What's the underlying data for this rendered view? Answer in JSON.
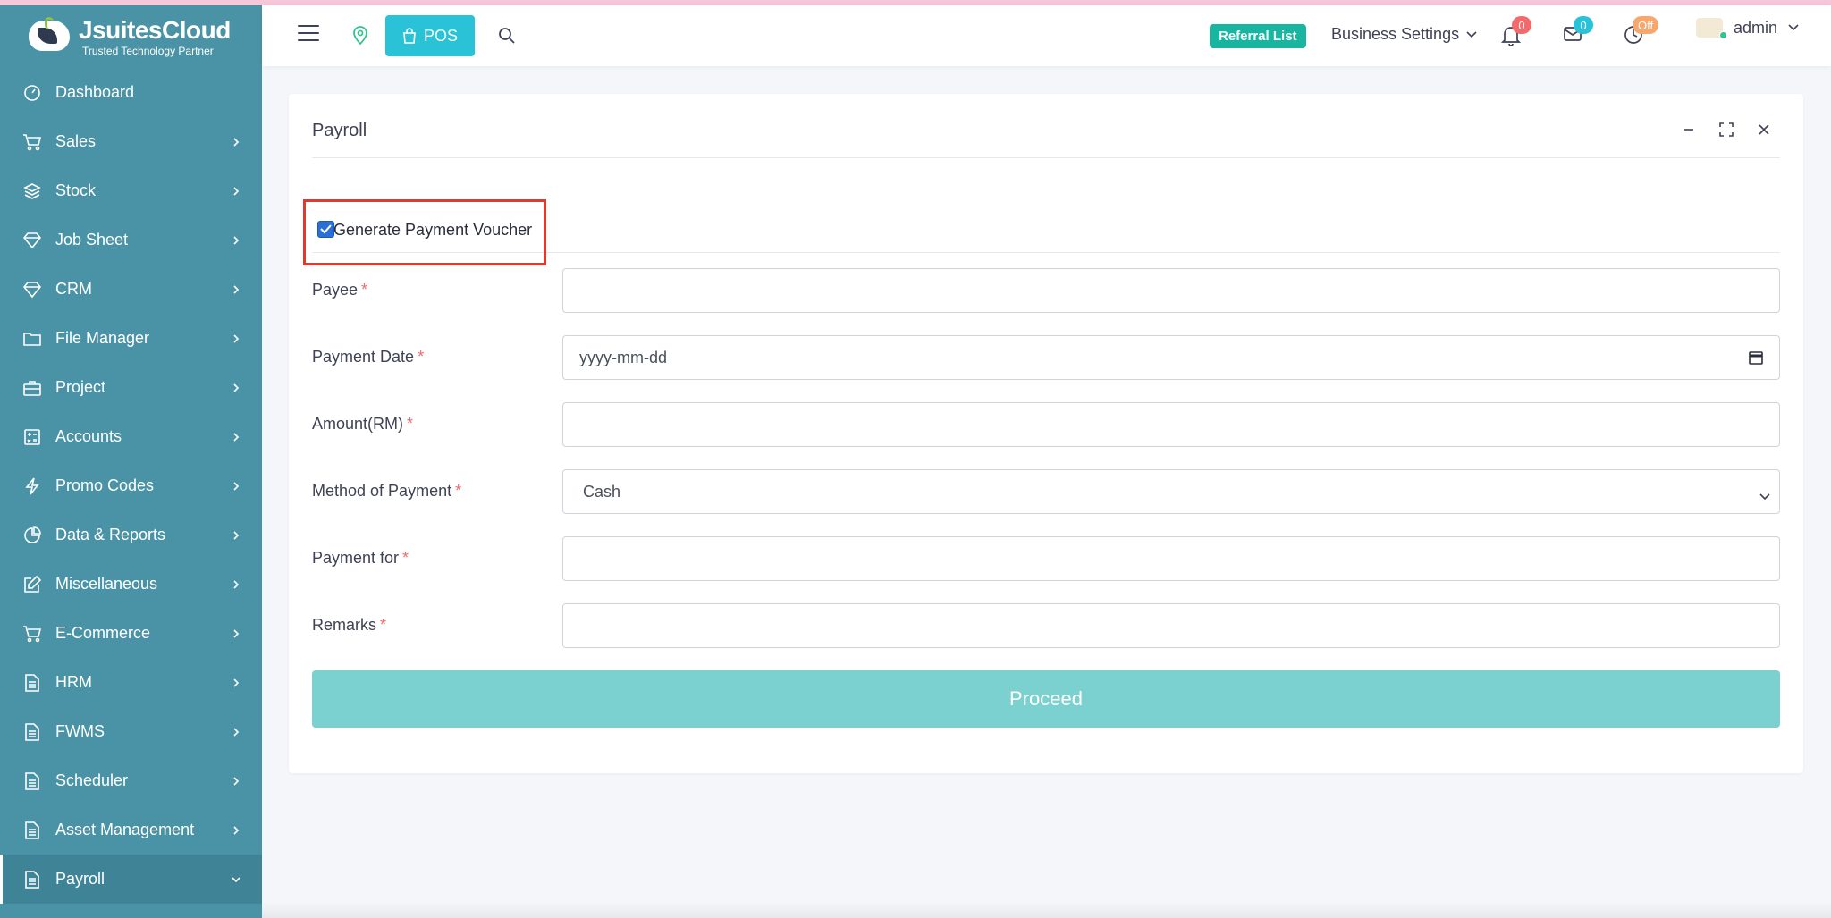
{
  "brand": {
    "name": "JsuitesCloud",
    "tagline": "Trusted Technology Partner"
  },
  "sidebar": {
    "items": [
      {
        "label": "Dashboard",
        "icon": "gauge-icon"
      },
      {
        "label": "Sales",
        "icon": "basket-icon"
      },
      {
        "label": "Stock",
        "icon": "layers-icon"
      },
      {
        "label": "Job Sheet",
        "icon": "diamond-icon"
      },
      {
        "label": "CRM",
        "icon": "diamond-icon"
      },
      {
        "label": "File Manager",
        "icon": "folder-icon"
      },
      {
        "label": "Project",
        "icon": "briefcase-icon"
      },
      {
        "label": "Accounts",
        "icon": "calculator-icon"
      },
      {
        "label": "Promo Codes",
        "icon": "lightning-icon"
      },
      {
        "label": "Data & Reports",
        "icon": "pie-chart-icon"
      },
      {
        "label": "Miscellaneous",
        "icon": "edit-icon"
      },
      {
        "label": "E-Commerce",
        "icon": "cart-icon"
      },
      {
        "label": "HRM",
        "icon": "document-icon"
      },
      {
        "label": "FWMS",
        "icon": "document-icon"
      },
      {
        "label": "Scheduler",
        "icon": "document-icon"
      },
      {
        "label": "Asset Management",
        "icon": "document-icon"
      },
      {
        "label": "Payroll",
        "icon": "document-icon"
      }
    ]
  },
  "header": {
    "pos_label": "POS",
    "referral_label": "Referral List",
    "business_settings_label": "Business Settings",
    "notifications_count": "0",
    "messages_count": "0",
    "clock_status": "Off",
    "user_name": "admin"
  },
  "card": {
    "title": "Payroll",
    "voucher_label": "Generate Payment Voucher",
    "fields": {
      "payee": {
        "label": "Payee",
        "required": "*",
        "value": ""
      },
      "payment_date": {
        "label": "Payment Date",
        "required": "*",
        "placeholder": "yyyy-mm-dd"
      },
      "amount": {
        "label": "Amount(RM)",
        "required": "*",
        "value": ""
      },
      "method": {
        "label": "Method of Payment",
        "required": "*",
        "selected": "Cash"
      },
      "payment_for": {
        "label": "Payment for",
        "required": "*",
        "value": ""
      },
      "remarks": {
        "label": "Remarks",
        "required": "*",
        "value": ""
      }
    },
    "proceed_label": "Proceed"
  },
  "colors": {
    "sidebar_bg": "#4a93a6",
    "pos_button": "#29c2d6",
    "referral_badge": "#18b6a0",
    "proceed_button": "#7bd1d0",
    "highlight_box": "#e03a2e"
  }
}
